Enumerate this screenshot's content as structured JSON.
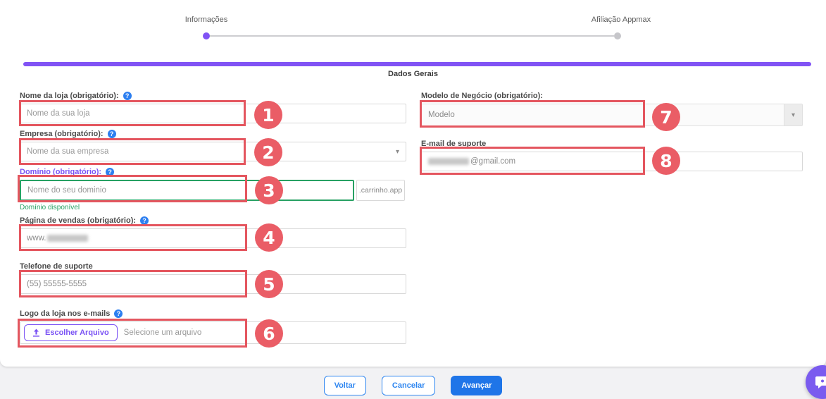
{
  "page": {
    "section_title": "Dados Gerais"
  },
  "stepper": {
    "steps": [
      {
        "label": "Informações",
        "active": true
      },
      {
        "label": "Afiliação Appmax",
        "active": false
      }
    ]
  },
  "form": {
    "store_name": {
      "label": "Nome da loja (obrigatório):",
      "placeholder": "Nome da sua loja"
    },
    "company": {
      "label": "Empresa (obrigatório):",
      "placeholder": "Nome da sua empresa"
    },
    "domain": {
      "label": "Domínio (obrigatório):",
      "placeholder": "Nome do seu dominio",
      "suffix": ".carrinho.app",
      "status": "Domínio disponível"
    },
    "sales_page": {
      "label": "Página de vendas (obrigatório):",
      "value_prefix": "www.",
      "masked": true
    },
    "support_phone": {
      "label": "Telefone de suporte",
      "value": "(55) 55555-5555"
    },
    "store_logo": {
      "label": "Logo da loja nos e-mails",
      "button_label": "Escolher Arquivo",
      "placeholder": "Selecione um arquivo"
    },
    "business_model": {
      "label": "Modelo de Negócio (obrigatório):",
      "value": "Modelo"
    },
    "support_email": {
      "label": "E-mail de suporte",
      "masked": true,
      "value_suffix": "@gmail.com"
    }
  },
  "annotations": {
    "badges": [
      "1",
      "2",
      "3",
      "4",
      "5",
      "6",
      "7",
      "8"
    ]
  },
  "footer": {
    "back_label": "Voltar",
    "cancel_label": "Cancelar",
    "next_label": "Avançar"
  },
  "icons": {
    "help": "?",
    "caret": "▾"
  },
  "colors": {
    "accent_purple": "#8153f5",
    "annotation_red": "#e4565f",
    "success_green": "#27a163",
    "primary_blue": "#1f75e8"
  }
}
